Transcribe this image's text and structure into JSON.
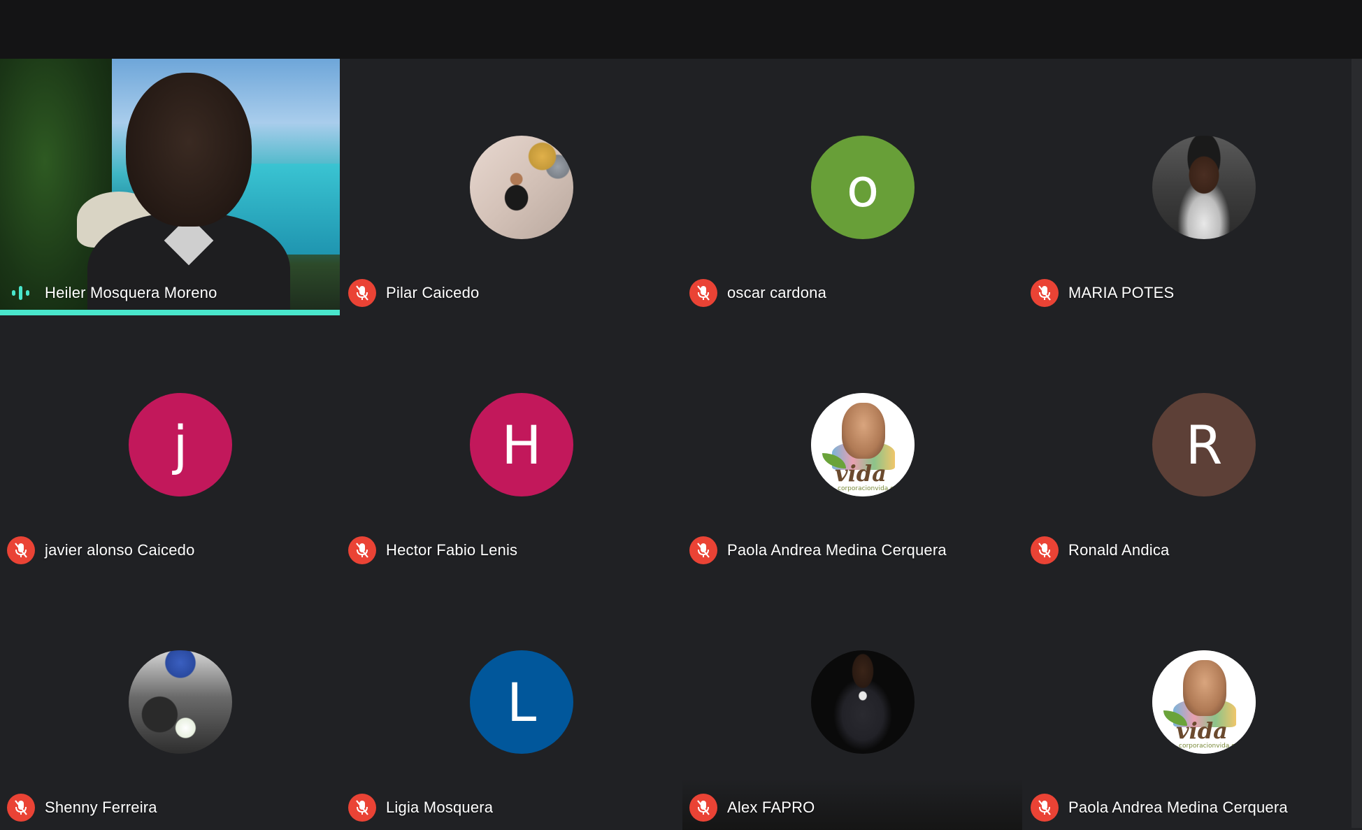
{
  "participants": [
    {
      "name": "Heiler Mosquera Moreno",
      "type": "video",
      "speaking": true
    },
    {
      "name": "Pilar Caicedo",
      "type": "photo",
      "muted": true
    },
    {
      "name": "oscar cardona",
      "type": "initial",
      "initial": "o",
      "color": "#689f38",
      "muted": true
    },
    {
      "name": "MARIA POTES",
      "type": "photo",
      "muted": true
    },
    {
      "name": "javier alonso Caicedo",
      "type": "initial",
      "initial": "j",
      "color": "#c2185b",
      "muted": true
    },
    {
      "name": "Hector Fabio Lenis",
      "type": "initial",
      "initial": "H",
      "color": "#c2185b",
      "muted": true
    },
    {
      "name": "Paola Andrea Medina Cerquera",
      "type": "logo",
      "logo_text": "vida",
      "logo_sub": "corporacionvida.org",
      "muted": true
    },
    {
      "name": "Ronald Andica",
      "type": "initial",
      "initial": "R",
      "color": "#5d4037",
      "muted": true
    },
    {
      "name": "Shenny Ferreira",
      "type": "photo",
      "muted": true
    },
    {
      "name": "Ligia Mosquera",
      "type": "initial",
      "initial": "L",
      "color": "#01579b",
      "muted": true
    },
    {
      "name": "Alex FAPRO",
      "type": "photo",
      "muted": true
    },
    {
      "name": "Paola Andrea Medina Cerquera",
      "type": "logo",
      "logo_text": "vida",
      "logo_sub": "corporacionvida.org",
      "muted": true
    }
  ],
  "colors": {
    "background": "#202124",
    "mic_off": "#ea4335",
    "speaking": "#49e6cc"
  }
}
